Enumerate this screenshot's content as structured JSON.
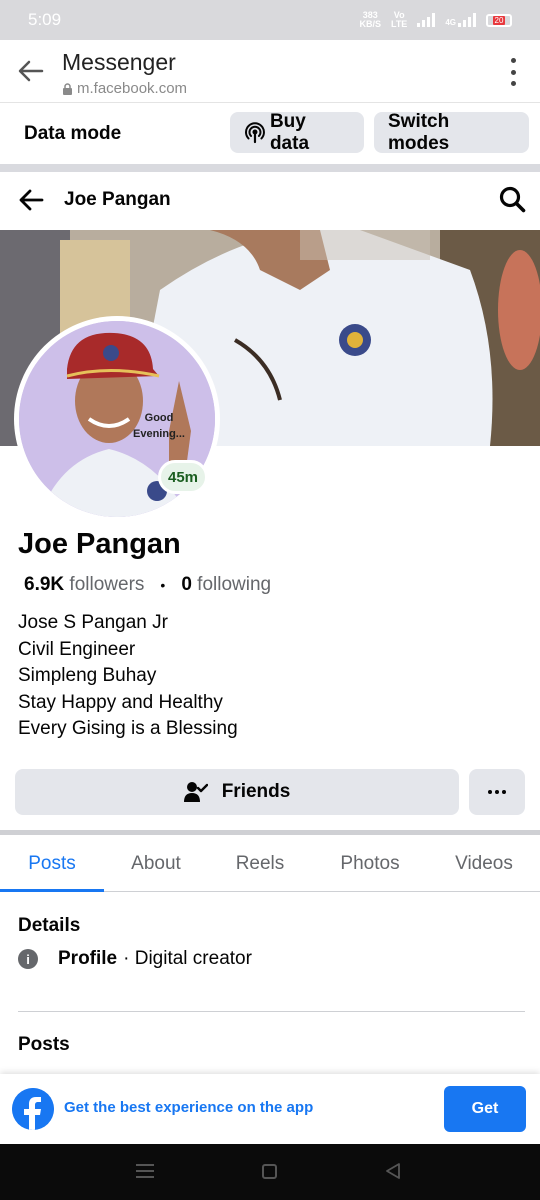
{
  "status_bar": {
    "time": "5:09",
    "speed_value": "383",
    "speed_unit": "KB/S",
    "volte_top": "Vo",
    "volte_bottom": "LTE",
    "network": "4G",
    "battery": "20"
  },
  "browser": {
    "title": "Messenger",
    "url": "m.facebook.com"
  },
  "data_mode": {
    "label": "Data mode",
    "buy_data": "Buy data",
    "switch_modes": "Switch modes"
  },
  "header": {
    "title": "Joe Pangan"
  },
  "avatar": {
    "caption_line1": "Good",
    "caption_line2": "Evening...",
    "story_age": "45m"
  },
  "profile": {
    "name": "Joe Pangan",
    "followers_count": "6.9K",
    "followers_label": "followers",
    "separator": "•",
    "following_count": "0",
    "following_label": "following",
    "bio": [
      "Jose S Pangan Jr",
      "Civil Engineer",
      "Simpleng Buhay",
      "Stay Happy and Healthy",
      "Every Gising is a Blessing"
    ]
  },
  "actions": {
    "friends": "Friends"
  },
  "tabs": [
    {
      "label": "Posts",
      "active": true
    },
    {
      "label": "About",
      "active": false
    },
    {
      "label": "Reels",
      "active": false
    },
    {
      "label": "Photos",
      "active": false
    },
    {
      "label": "Videos",
      "active": false
    }
  ],
  "details": {
    "title": "Details",
    "profile_label": "Profile",
    "profile_value": "· Digital creator"
  },
  "posts": {
    "title": "Posts"
  },
  "app_banner": {
    "text": "Get the best experience on the app",
    "button": "Get"
  },
  "colors": {
    "facebook_blue": "#1877f2",
    "secondary_text": "#65676b",
    "button_grey": "#e4e6eb"
  },
  "icons": [
    "back-arrow-icon",
    "lock-icon",
    "more-vert-icon",
    "broadcast-icon",
    "search-icon",
    "person-check-icon",
    "more-horiz-icon",
    "info-icon",
    "facebook-logo-icon",
    "nav-menu-icon",
    "nav-home-icon",
    "nav-back-icon"
  ]
}
